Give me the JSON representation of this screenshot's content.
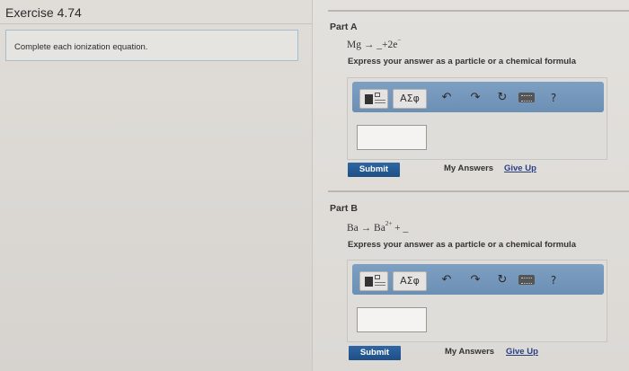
{
  "exercise": {
    "title": "Exercise 4.74",
    "instruction": "Complete each ionization equation."
  },
  "parts": [
    {
      "label": "Part A",
      "equation": {
        "lhs": "Mg",
        "arrow": "→",
        "rhs": "_+2e",
        "charge": "−"
      },
      "prompt": "Express your answer as a particle or a chemical formula",
      "toolbar": {
        "greek": "ΑΣφ",
        "help": "?"
      },
      "answer_value": "",
      "submit": "Submit",
      "my_answers": "My Answers",
      "give_up": "Give Up"
    },
    {
      "label": "Part B",
      "equation": {
        "lhs": "Ba",
        "arrow": "→",
        "rhs_base": "Ba",
        "rhs_charge": "2+",
        "rhs_tail": "+ _"
      },
      "prompt": "Express your answer as a particle or a chemical formula",
      "toolbar": {
        "greek": "ΑΣφ",
        "help": "?"
      },
      "answer_value": "",
      "submit": "Submit",
      "my_answers": "My Answers",
      "give_up": "Give Up"
    }
  ],
  "icons": {
    "template": "template-icon",
    "undo": "undo-icon",
    "redo": "redo-icon",
    "reset": "reset-icon",
    "keyboard": "keyboard-icon",
    "help": "help-icon"
  },
  "colors": {
    "toolbar": "#7596bb",
    "submit": "#2a5d98",
    "link": "#2a3f82"
  }
}
